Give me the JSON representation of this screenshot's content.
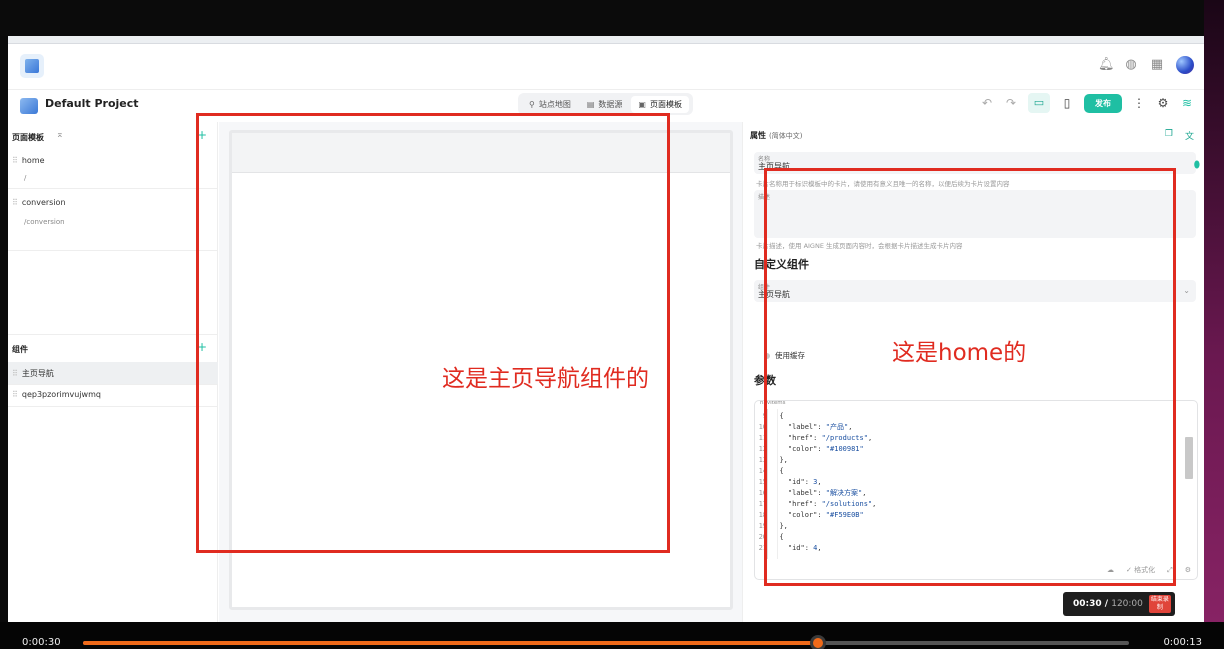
{
  "project": {
    "name": "Default Project"
  },
  "center_tabs": [
    {
      "label": "站点地图",
      "icon": "sitemap-icon"
    },
    {
      "label": "数据源",
      "icon": "database-icon"
    },
    {
      "label": "页面模板",
      "icon": "template-icon"
    }
  ],
  "toolbar": {
    "publish_label": "发布"
  },
  "left_panel": {
    "pages_title": "页面模板",
    "pages": [
      {
        "name": "home",
        "path": "/"
      },
      {
        "name": "conversion",
        "path": "/conversion"
      }
    ],
    "components_title": "组件",
    "components": [
      "主页导航",
      "qep3pzorimvujwmq"
    ]
  },
  "properties": {
    "title": "属性",
    "language": "(简体中文)",
    "name_label": "名称",
    "name_value": "主页导航",
    "name_hint": "卡片名称用于标识模板中的卡片，请使用有意义且唯一的名称，以便后续为卡片设置内容",
    "desc_label": "描述",
    "desc_hint": "卡片描述，使用 AIGNE 生成页面内容时，会根据卡片描述生成卡片内容",
    "custom_title": "自定义组件",
    "component_label": "组件",
    "component_value": "主页导航",
    "cache_label": "使用缓存",
    "params_title": "参数",
    "editor_label": "navItems",
    "format_label": "格式化"
  },
  "code_lines": [
    {
      "ln": "9",
      "indent": "  ",
      "text": "{"
    },
    {
      "ln": "10",
      "indent": "    ",
      "key": "\"label\": ",
      "val": "\"产品\"",
      "tail": ","
    },
    {
      "ln": "11",
      "indent": "    ",
      "key": "\"href\": ",
      "val": "\"/products\"",
      "tail": ","
    },
    {
      "ln": "12",
      "indent": "    ",
      "key": "\"color\": ",
      "val": "\"#100981\"",
      "tail": ""
    },
    {
      "ln": "13",
      "indent": "  ",
      "text": "},"
    },
    {
      "ln": "14",
      "indent": "  ",
      "text": "{"
    },
    {
      "ln": "15",
      "indent": "    ",
      "key": "\"id\": ",
      "val": "3",
      "tail": ","
    },
    {
      "ln": "16",
      "indent": "    ",
      "key": "\"label\": ",
      "val": "\"解决方案\"",
      "tail": ","
    },
    {
      "ln": "17",
      "indent": "    ",
      "key": "\"href\": ",
      "val": "\"/solutions\"",
      "tail": ","
    },
    {
      "ln": "18",
      "indent": "    ",
      "key": "\"color\": ",
      "val": "\"#F59E0B\"",
      "tail": ""
    },
    {
      "ln": "19",
      "indent": "  ",
      "text": "},"
    },
    {
      "ln": "20",
      "indent": "  ",
      "text": "{"
    },
    {
      "ln": "21",
      "indent": "    ",
      "key": "\"id\": ",
      "val": "4",
      "tail": ","
    }
  ],
  "annotations": {
    "left": "这是主页导航组件的",
    "right": "这是home的"
  },
  "recorder": {
    "elapsed": "00:30",
    "total": "120:00",
    "badge": "结束录制"
  },
  "player": {
    "current": "0:00:30",
    "remaining": "0:00:13",
    "progress": 0.703
  },
  "colors": {
    "accent": "#1fbfa3",
    "annotation": "#e02b20",
    "progress": "#f06a1a"
  }
}
